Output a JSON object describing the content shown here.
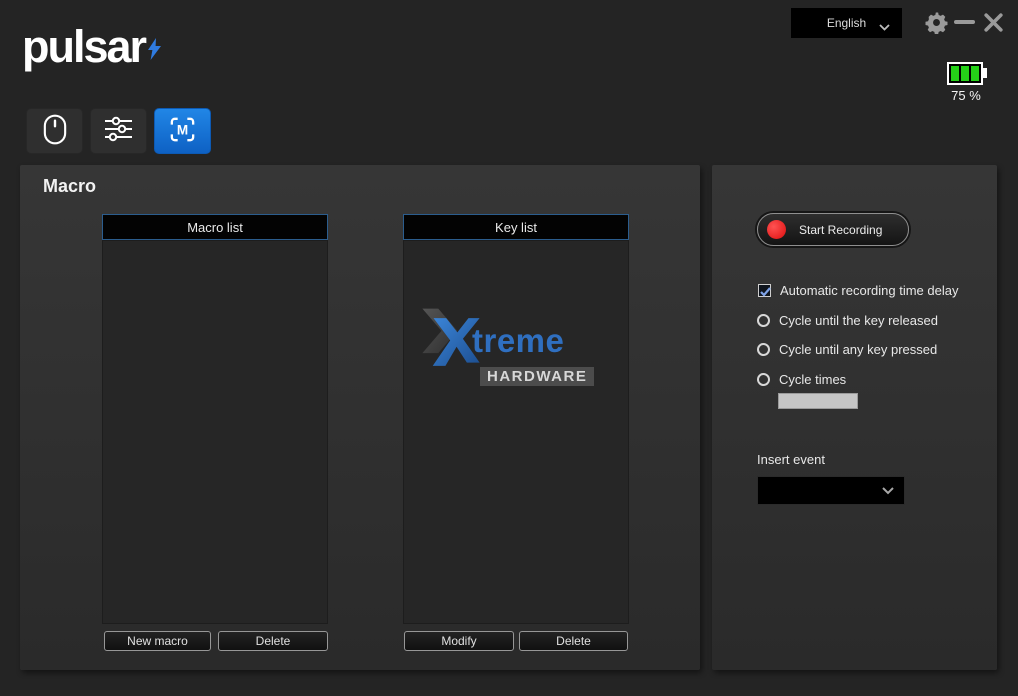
{
  "titlebar": {
    "language_selected": "English",
    "battery_percent": "75 %",
    "battery_bars": 3
  },
  "logo_text": "pulsar",
  "tabs": [
    {
      "id": "mouse",
      "active": false
    },
    {
      "id": "settings",
      "active": false
    },
    {
      "id": "macro",
      "active": true,
      "glyph": "M"
    }
  ],
  "macro_page": {
    "title": "Macro",
    "macro_list": {
      "header": "Macro list",
      "items": [],
      "new_button": "New macro",
      "delete_button": "Delete"
    },
    "key_list": {
      "header": "Key list",
      "items": [],
      "modify_button": "Modify",
      "delete_button": "Delete"
    },
    "watermark": {
      "treme": "treme",
      "hardware": "HARDWARE"
    }
  },
  "controls": {
    "start_recording_label": "Start Recording",
    "auto_delay": {
      "label": "Automatic recording time delay",
      "checked": true
    },
    "radios": [
      {
        "label": "Cycle until the key released",
        "selected": false
      },
      {
        "label": "Cycle until any key pressed",
        "selected": false
      },
      {
        "label": "Cycle times",
        "selected": false
      }
    ],
    "cycle_times_value": "",
    "insert_event_label": "Insert event",
    "insert_event_selected": ""
  },
  "icons": {
    "logo_bolt": "lightning-bolt-icon",
    "language_chevron": "chevron-down-icon",
    "gear": "gear-icon",
    "minimize": "minimize-icon",
    "close": "close-icon",
    "tab_mouse": "mouse-icon",
    "tab_settings": "sliders-icon",
    "tab_macro": "macro-m-icon",
    "macro_m_glyph": "M",
    "battery": "battery-icon",
    "record_dot": "record-dot-icon",
    "event_chevron": "chevron-down-icon"
  },
  "colors": {
    "accent_blue": "#1173d4",
    "record_red": "#dc0e0e",
    "battery_green": "#25d018",
    "list_header_border": "#2b5d8e",
    "watermark_blue": "#2f6fc0"
  }
}
